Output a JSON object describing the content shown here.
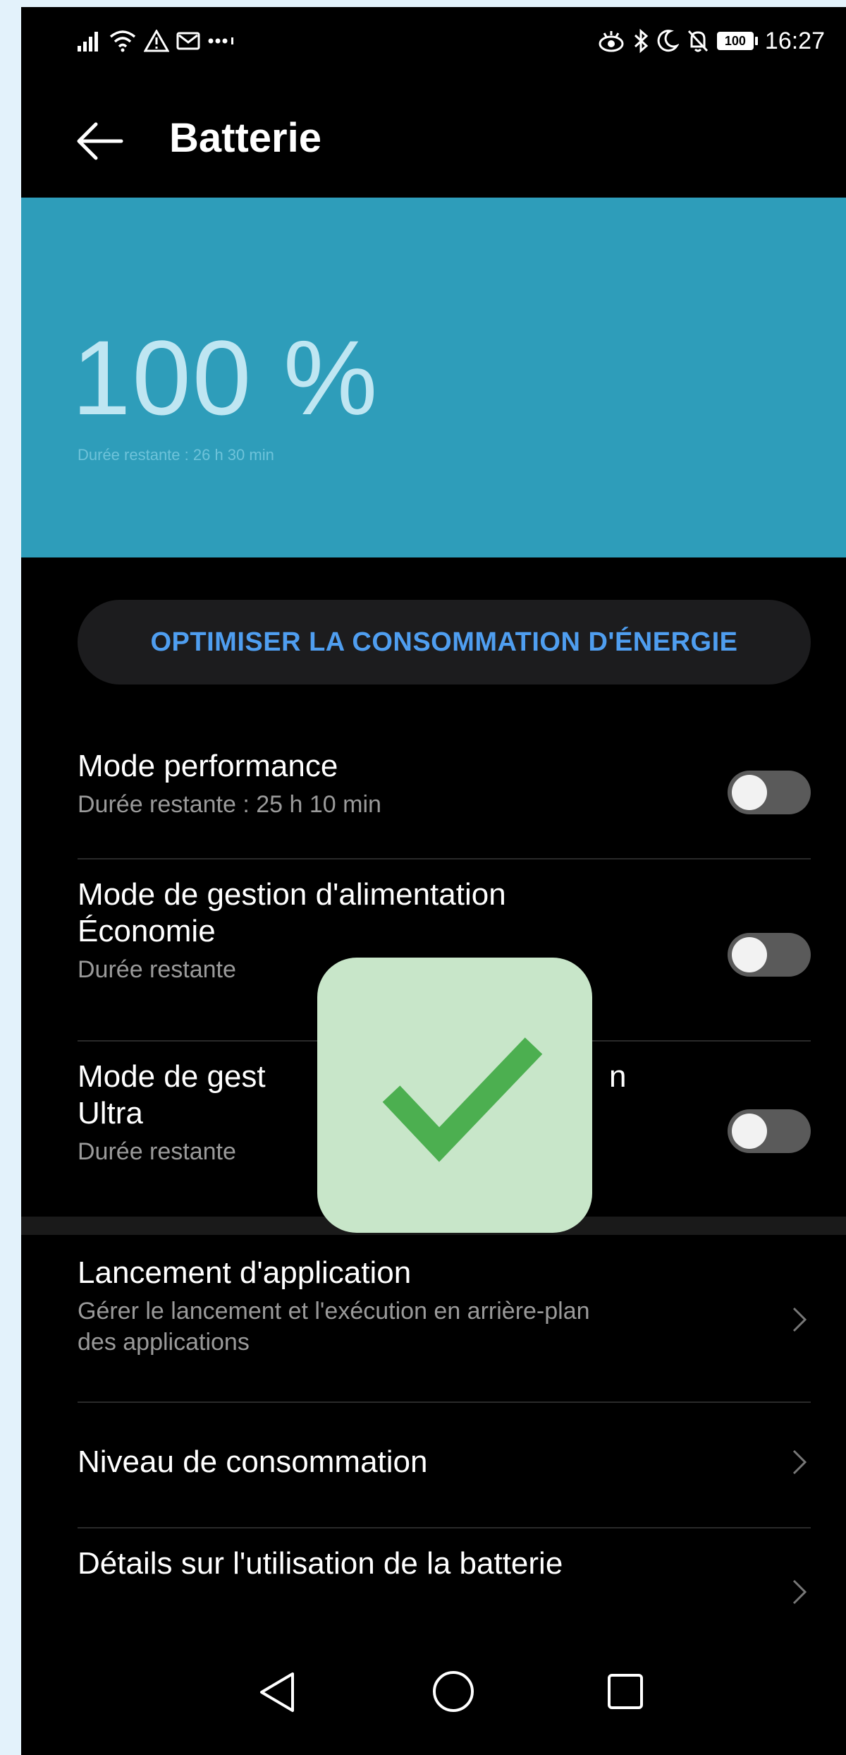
{
  "status_bar": {
    "time": "16:27",
    "battery_level": "100"
  },
  "header": {
    "title": "Batterie"
  },
  "battery": {
    "percent": "100 %",
    "remaining": "Durée restante : 26 h 30 min"
  },
  "optimize_button": {
    "label": "OPTIMISER LA CONSOMMATION D'ÉNERGIE"
  },
  "modes": [
    {
      "title": "Mode performance",
      "subtitle": "Durée restante : 25 h 10 min",
      "enabled": false
    },
    {
      "title": "Mode de gestion d'alimentation Économie",
      "subtitle": "Durée restante",
      "enabled": false
    },
    {
      "title": "Mode de gest",
      "title_tail": "n",
      "title_line2": "Ultra",
      "subtitle": "Durée restante",
      "enabled": false
    }
  ],
  "links": [
    {
      "title": "Lancement d'application",
      "subtitle": "Gérer le lancement et l'exécution en arrière-plan des applications"
    },
    {
      "title": "Niveau de consommation"
    },
    {
      "title": "Détails sur l'utilisation de la batterie"
    }
  ],
  "colors": {
    "hero_bg": "#2e9dba",
    "accent_blue": "#4f9ef0",
    "check_green": "#4caf50",
    "check_bg": "#c8e6c9"
  }
}
